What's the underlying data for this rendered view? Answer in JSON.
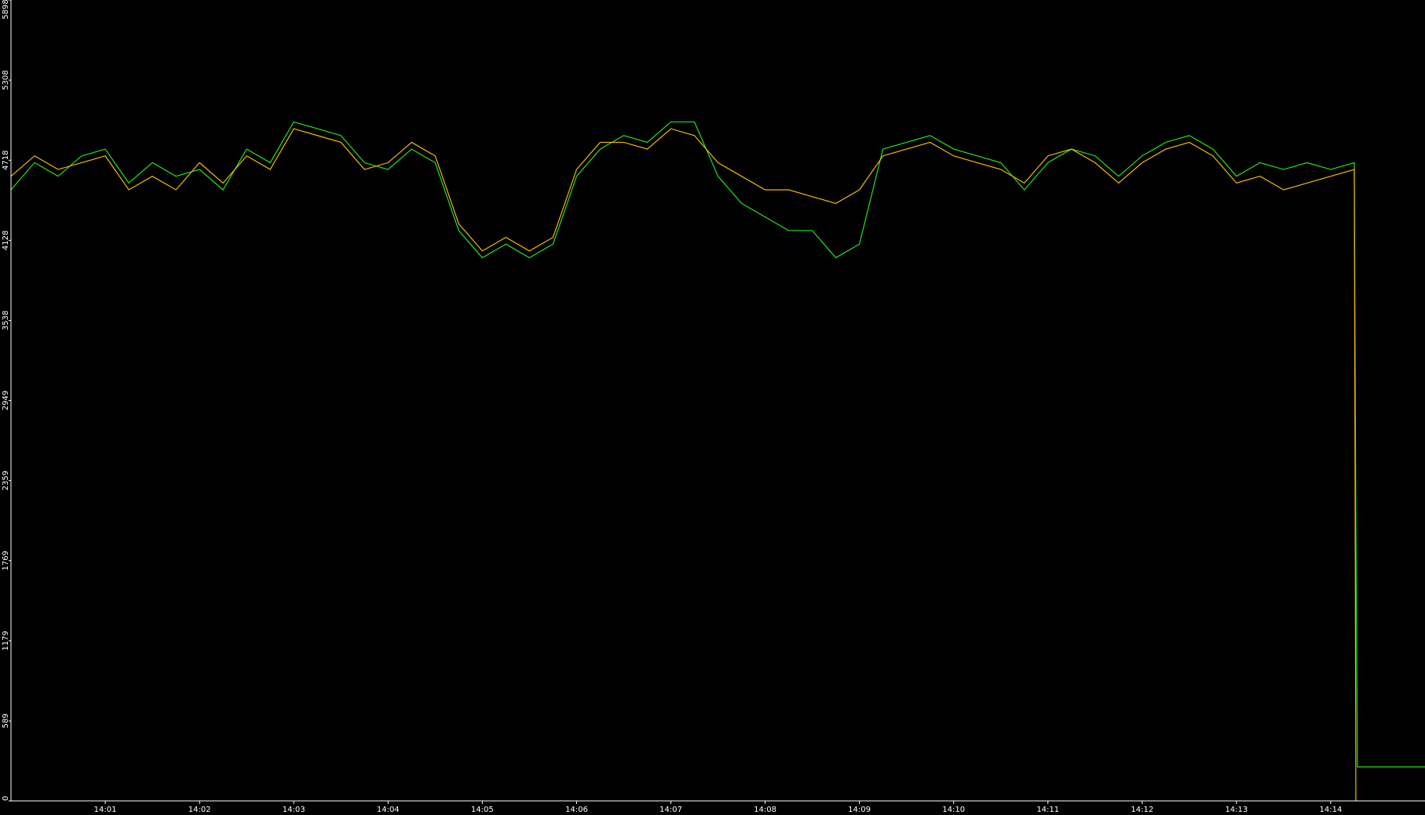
{
  "chart_data": {
    "type": "line",
    "title": "",
    "xlabel": "",
    "ylabel": "",
    "ylim": [
      0,
      5898
    ],
    "xlim": [
      "14:00:00",
      "14:15:00"
    ],
    "y_ticks": [
      0,
      589,
      1179,
      1769,
      2359,
      2949,
      3538,
      4128,
      4718,
      5308,
      5898
    ],
    "x_ticks": [
      "14:01",
      "14:02",
      "14:03",
      "14:04",
      "14:05",
      "14:06",
      "14:07",
      "14:08",
      "14:09",
      "14:10",
      "14:11",
      "14:12",
      "14:13",
      "14:14"
    ],
    "grid": false,
    "legend": "none",
    "series": [
      {
        "color": "#22e31c",
        "x": [
          "14:00:00",
          "14:00:15",
          "14:00:30",
          "14:00:45",
          "14:01:00",
          "14:01:15",
          "14:01:30",
          "14:01:45",
          "14:02:00",
          "14:02:15",
          "14:02:30",
          "14:02:45",
          "14:03:00",
          "14:03:15",
          "14:03:30",
          "14:03:45",
          "14:04:00",
          "14:04:15",
          "14:04:30",
          "14:04:45",
          "14:05:00",
          "14:05:15",
          "14:05:30",
          "14:05:45",
          "14:06:00",
          "14:06:15",
          "14:06:30",
          "14:06:45",
          "14:07:00",
          "14:07:15",
          "14:07:30",
          "14:07:45",
          "14:08:00",
          "14:08:15",
          "14:08:30",
          "14:08:45",
          "14:09:00",
          "14:09:15",
          "14:09:30",
          "14:09:45",
          "14:10:00",
          "14:10:15",
          "14:10:30",
          "14:10:45",
          "14:11:00",
          "14:11:15",
          "14:11:30",
          "14:11:45",
          "14:12:00",
          "14:12:15",
          "14:12:30",
          "14:12:45",
          "14:13:00",
          "14:13:15",
          "14:13:30",
          "14:13:45",
          "14:14:00",
          "14:14:15",
          "14:14:16",
          "14:14:17",
          "14:14:30",
          "14:14:45",
          "14:15:00"
        ],
        "y": [
          4500,
          4700,
          4600,
          4750,
          4800,
          4550,
          4700,
          4600,
          4650,
          4500,
          4800,
          4700,
          5000,
          4950,
          4900,
          4700,
          4650,
          4800,
          4700,
          4200,
          4000,
          4100,
          4000,
          4100,
          4600,
          4800,
          4900,
          4850,
          5000,
          5000,
          4600,
          4400,
          4300,
          4200,
          4200,
          4000,
          4100,
          4800,
          4850,
          4900,
          4800,
          4750,
          4700,
          4500,
          4700,
          4800,
          4750,
          4600,
          4750,
          4850,
          4900,
          4800,
          4600,
          4700,
          4650,
          4700,
          4650,
          4700,
          2000,
          250,
          250,
          250,
          250
        ]
      },
      {
        "color": "#f2b705",
        "x": [
          "14:00:00",
          "14:00:15",
          "14:00:30",
          "14:00:45",
          "14:01:00",
          "14:01:15",
          "14:01:30",
          "14:01:45",
          "14:02:00",
          "14:02:15",
          "14:02:30",
          "14:02:45",
          "14:03:00",
          "14:03:15",
          "14:03:30",
          "14:03:45",
          "14:04:00",
          "14:04:15",
          "14:04:30",
          "14:04:45",
          "14:05:00",
          "14:05:15",
          "14:05:30",
          "14:05:45",
          "14:06:00",
          "14:06:15",
          "14:06:30",
          "14:06:45",
          "14:07:00",
          "14:07:15",
          "14:07:30",
          "14:07:45",
          "14:08:00",
          "14:08:15",
          "14:08:30",
          "14:08:45",
          "14:09:00",
          "14:09:15",
          "14:09:30",
          "14:09:45",
          "14:10:00",
          "14:10:15",
          "14:10:30",
          "14:10:45",
          "14:11:00",
          "14:11:15",
          "14:11:30",
          "14:11:45",
          "14:12:00",
          "14:12:15",
          "14:12:30",
          "14:12:45",
          "14:13:00",
          "14:13:15",
          "14:13:30",
          "14:13:45",
          "14:14:00",
          "14:14:15",
          "14:14:16"
        ],
        "y": [
          4600,
          4750,
          4650,
          4700,
          4750,
          4500,
          4600,
          4500,
          4700,
          4550,
          4750,
          4650,
          4950,
          4900,
          4850,
          4650,
          4700,
          4850,
          4750,
          4250,
          4050,
          4150,
          4050,
          4150,
          4650,
          4850,
          4850,
          4800,
          4950,
          4900,
          4700,
          4600,
          4500,
          4500,
          4450,
          4400,
          4500,
          4750,
          4800,
          4850,
          4750,
          4700,
          4650,
          4550,
          4750,
          4800,
          4700,
          4550,
          4700,
          4800,
          4850,
          4750,
          4550,
          4600,
          4500,
          4550,
          4600,
          4650,
          0
        ]
      }
    ]
  }
}
